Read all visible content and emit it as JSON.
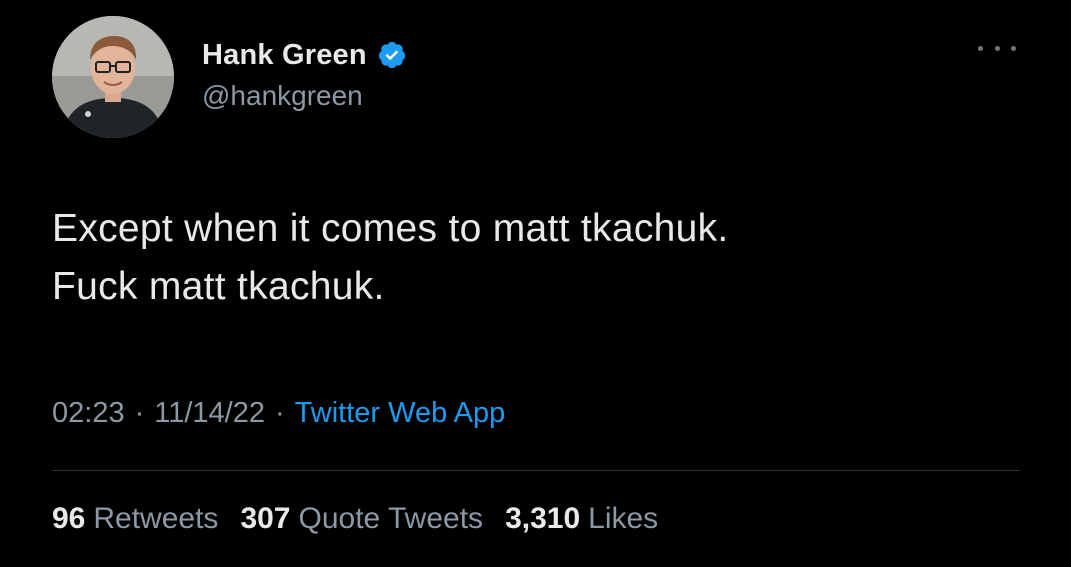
{
  "author": {
    "display_name": "Hank Green",
    "handle": "@hankgreen",
    "verified": true,
    "avatar_icon": "profile-photo"
  },
  "tweet": {
    "text_lines": [
      "Except when it comes to matt tkachuk.",
      "Fuck matt tkachuk."
    ],
    "time": "02:23",
    "separator": "·",
    "date": "11/14/22",
    "source": "Twitter Web App"
  },
  "stats": {
    "retweets_count": "96",
    "retweets_label": "Retweets",
    "quotes_count": "307",
    "quotes_label": "Quote Tweets",
    "likes_count": "3,310",
    "likes_label": "Likes"
  },
  "colors": {
    "background": "#000000",
    "primary_text": "#e7e9ea",
    "secondary_text": "#8b98a5",
    "link": "#1d9bf0",
    "verified_badge": "#1d9bf0",
    "divider": "#2f3336"
  },
  "icons": {
    "verified": "verified-badge-icon",
    "more": "more-options-icon"
  }
}
